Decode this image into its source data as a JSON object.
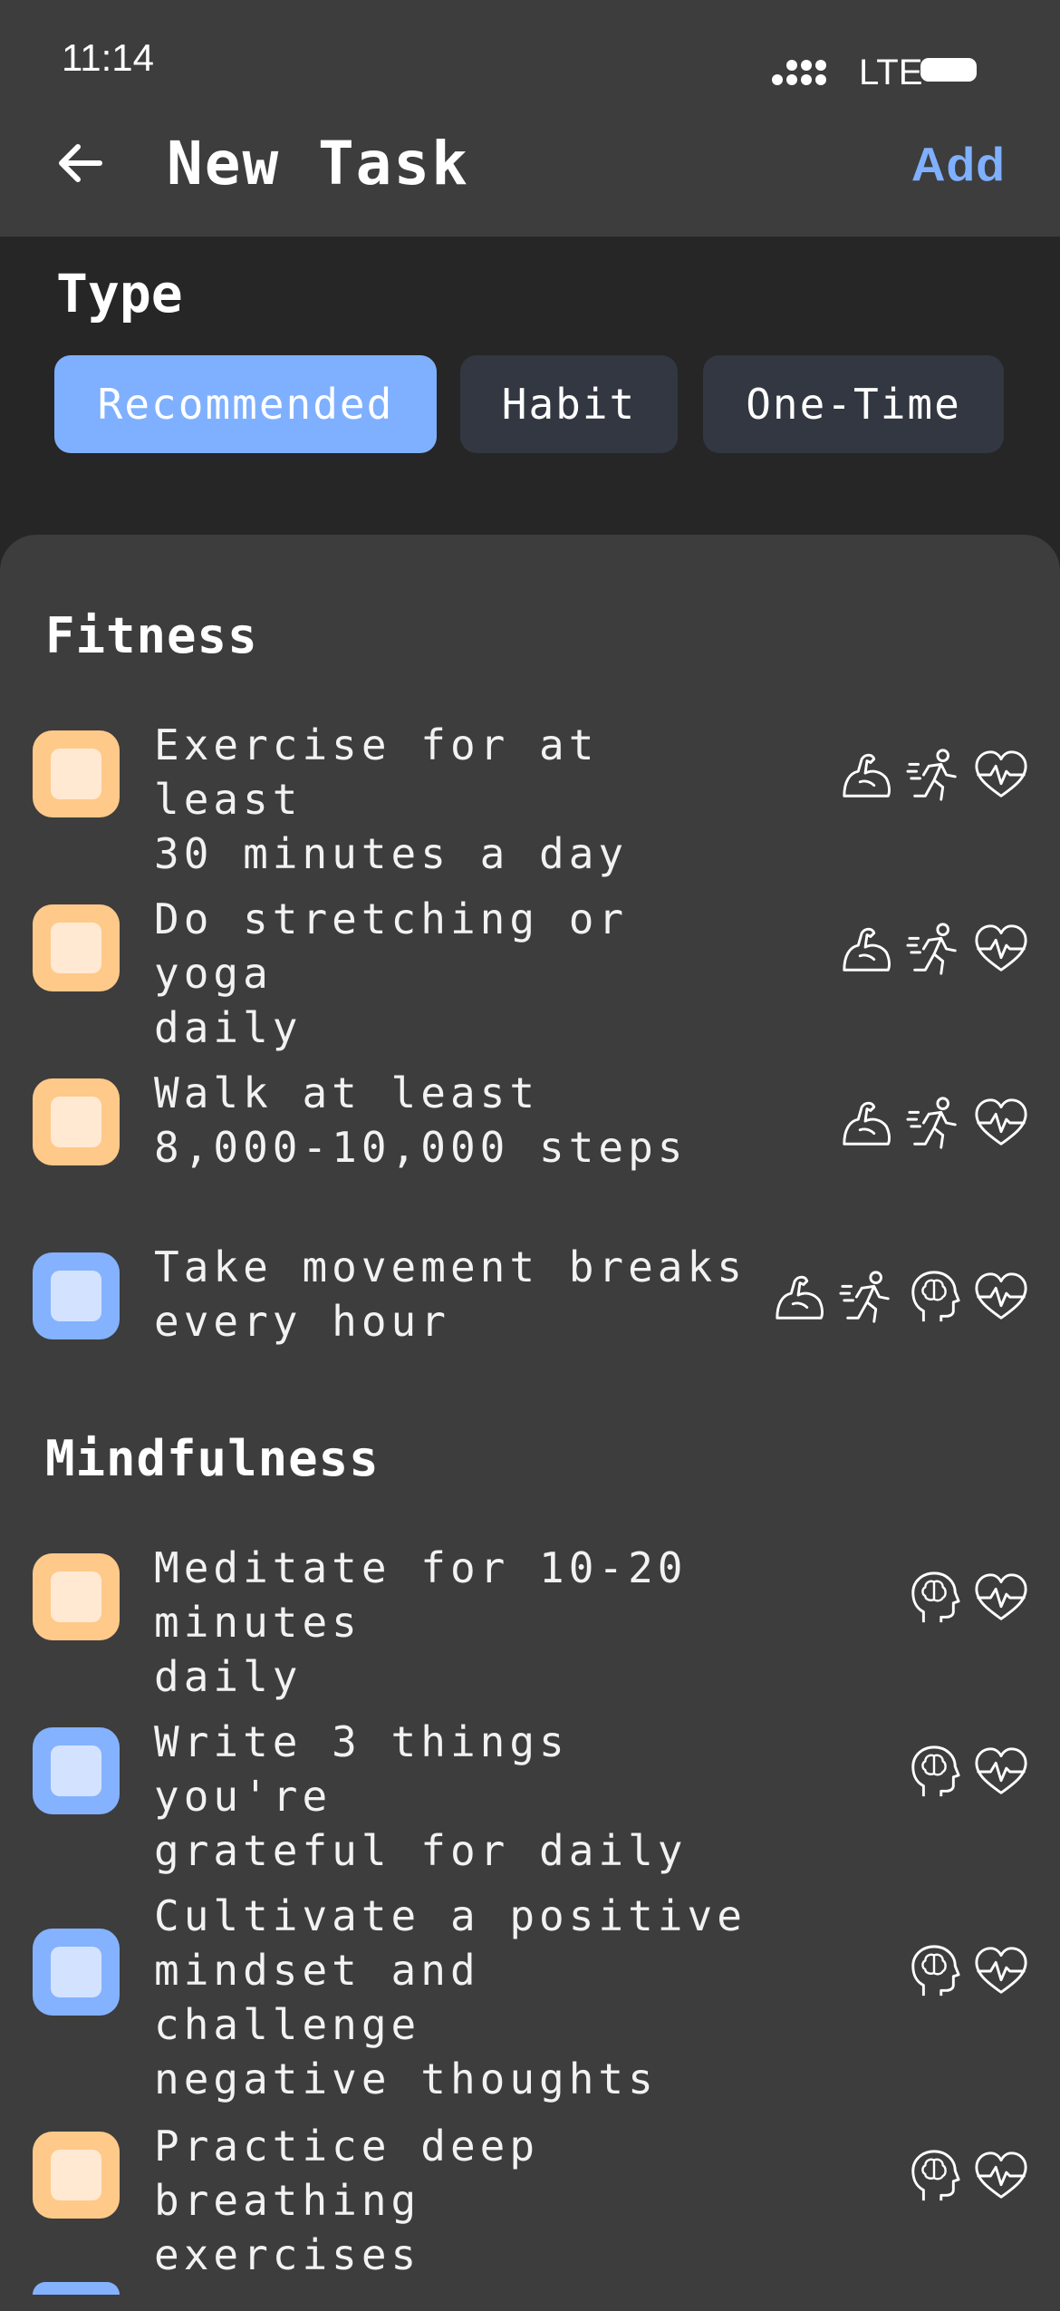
{
  "status_bar": {
    "time": "11:14",
    "network": "LTE"
  },
  "header": {
    "title": "New Task",
    "add_label": "Add"
  },
  "type": {
    "label": "Type",
    "options": [
      "Recommended",
      "Habit",
      "One-Time"
    ],
    "selected": "Recommended"
  },
  "sections": [
    {
      "title": "Fitness",
      "tasks": [
        {
          "text": "Exercise for at least\n30 minutes a day",
          "color": "orange",
          "icons": [
            "muscle-icon",
            "running-icon",
            "heart-pulse-icon"
          ]
        },
        {
          "text": "Do stretching or yoga\ndaily",
          "color": "orange",
          "icons": [
            "muscle-icon",
            "running-icon",
            "heart-pulse-icon"
          ]
        },
        {
          "text": "Walk at least\n8,000-10,000 steps",
          "color": "orange",
          "icons": [
            "muscle-icon",
            "running-icon",
            "heart-pulse-icon"
          ]
        },
        {
          "text": "Take movement breaks\nevery hour",
          "color": "blue",
          "icons": [
            "muscle-icon",
            "running-icon",
            "brain-head-icon",
            "heart-pulse-icon"
          ]
        }
      ]
    },
    {
      "title": "Mindfulness",
      "tasks": [
        {
          "text": "Meditate for 10-20 minutes\ndaily",
          "color": "orange",
          "icons": [
            "brain-head-icon",
            "heart-pulse-icon"
          ]
        },
        {
          "text": "Write 3 things you're\ngrateful for daily",
          "color": "blue",
          "icons": [
            "brain-head-icon",
            "heart-pulse-icon"
          ]
        },
        {
          "text": "Cultivate a positive\nmindset and challenge\nnegative thoughts",
          "color": "blue",
          "icons": [
            "brain-head-icon",
            "heart-pulse-icon"
          ]
        },
        {
          "text": "Practice deep breathing\nexercises",
          "color": "orange",
          "icons": [
            "brain-head-icon",
            "heart-pulse-icon"
          ]
        }
      ]
    }
  ],
  "colors": {
    "accent": "#7fb0ff",
    "orange_checkbox": "#ffc98a",
    "blue_checkbox": "#84b2ff",
    "sheet_bg": "#3d3d3d",
    "page_bg": "#262626"
  }
}
